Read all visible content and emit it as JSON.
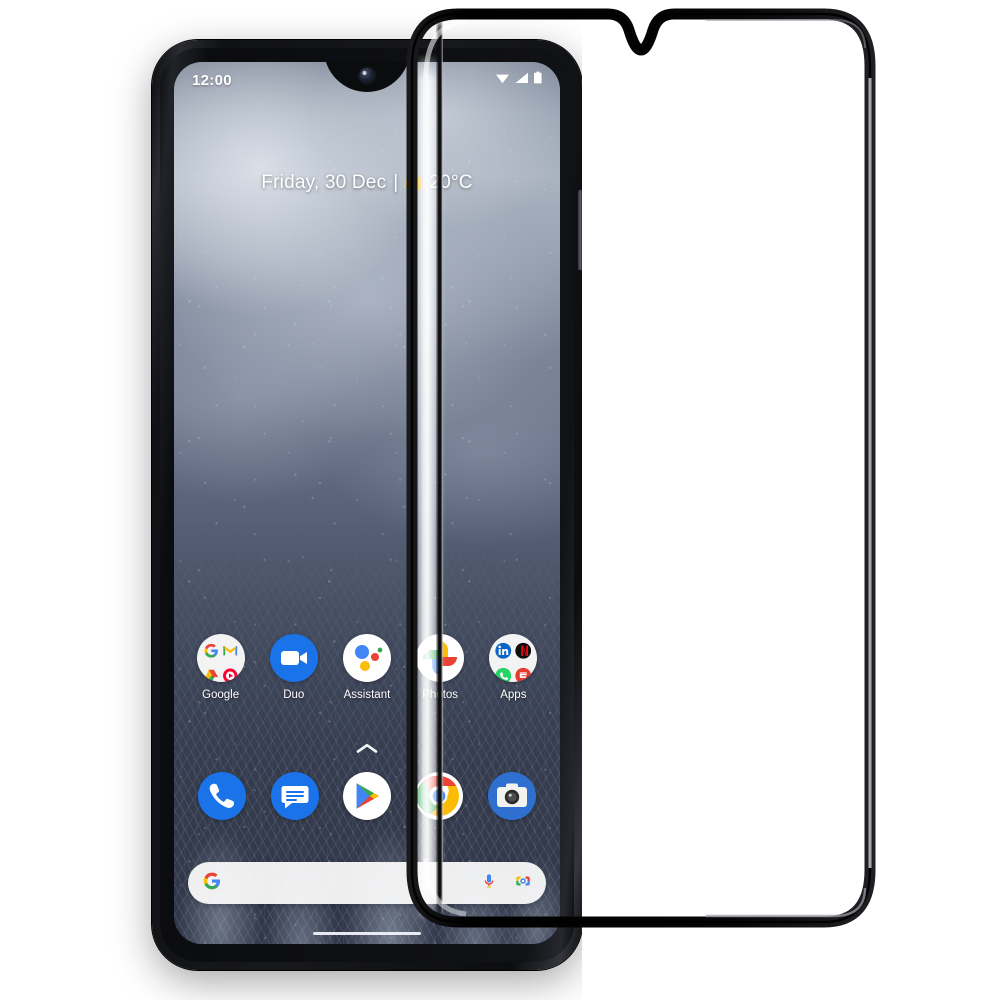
{
  "scene": {
    "subject": "smartphone-with-tempered-glass-screen-protector",
    "background_color": "#ffffff"
  },
  "phone": {
    "hardware": {
      "frame_color": "#17181c",
      "earpiece": "earpiece-speaker-grille",
      "front_camera": "front-camera-waterdrop-notch",
      "side_button": "power-button",
      "nav_gesture_pill": "navigation-gesture-bar"
    },
    "screen": {
      "wallpaper_description": "winter sky with frosted treeline",
      "status_bar": {
        "time": "12:00",
        "icons": [
          "wifi-icon",
          "signal-icon",
          "battery-icon"
        ]
      },
      "date_widget": {
        "date": "Friday, 30 Dec",
        "separator": "|",
        "weather_icon": "sun-icon",
        "temperature": "20°C"
      },
      "app_row": [
        {
          "label": "Google",
          "icon": "google-folder-icon",
          "type": "folder",
          "contents": [
            "google-search-icon",
            "gmail-icon",
            "google-drive-icon",
            "youtube-music-icon"
          ]
        },
        {
          "label": "Duo",
          "icon": "google-duo-icon",
          "type": "app",
          "color": "#1a73e8"
        },
        {
          "label": "Assistant",
          "icon": "google-assistant-icon",
          "type": "app",
          "color": "#ffffff"
        },
        {
          "label": "Photos",
          "icon": "google-photos-icon",
          "type": "app",
          "color": "#ffffff"
        },
        {
          "label": "Apps",
          "icon": "apps-folder-icon",
          "type": "folder",
          "contents": [
            "linkedin-icon",
            "netflix-icon",
            "whatsapp-icon",
            "gumtree-icon"
          ]
        }
      ],
      "drawer_chevron": "⌃",
      "dock": [
        {
          "label": "Phone",
          "icon": "phone-icon",
          "color": "#1a73e8"
        },
        {
          "label": "Messages",
          "icon": "messages-icon",
          "color": "#1a73e8"
        },
        {
          "label": "Play Store",
          "icon": "google-play-icon",
          "color": "#ffffff"
        },
        {
          "label": "Chrome",
          "icon": "chrome-icon",
          "color": "#ffffff"
        },
        {
          "label": "Camera",
          "icon": "camera-icon",
          "color": "#2f6fd0"
        }
      ],
      "search_bar": {
        "leading_icon": "google-g-icon",
        "query": "",
        "placeholder": "",
        "trailing_icons": [
          "microphone-icon",
          "google-lens-icon"
        ]
      }
    }
  },
  "screen_protector": {
    "type": "tempered-glass-screen-protector",
    "frame_color": "#000000",
    "notch_cutout": "waterdrop-notch-cutout",
    "edge_highlight_color": "#ffffff"
  },
  "brand_colors": {
    "google_blue": "#4285F4",
    "google_red": "#EA4335",
    "google_yellow": "#FBBC05",
    "google_green": "#34A853",
    "duo_blue": "#1a73e8",
    "whatsapp_green": "#25D366",
    "linkedin_blue": "#0A66C2",
    "netflix_red": "#E50914"
  }
}
